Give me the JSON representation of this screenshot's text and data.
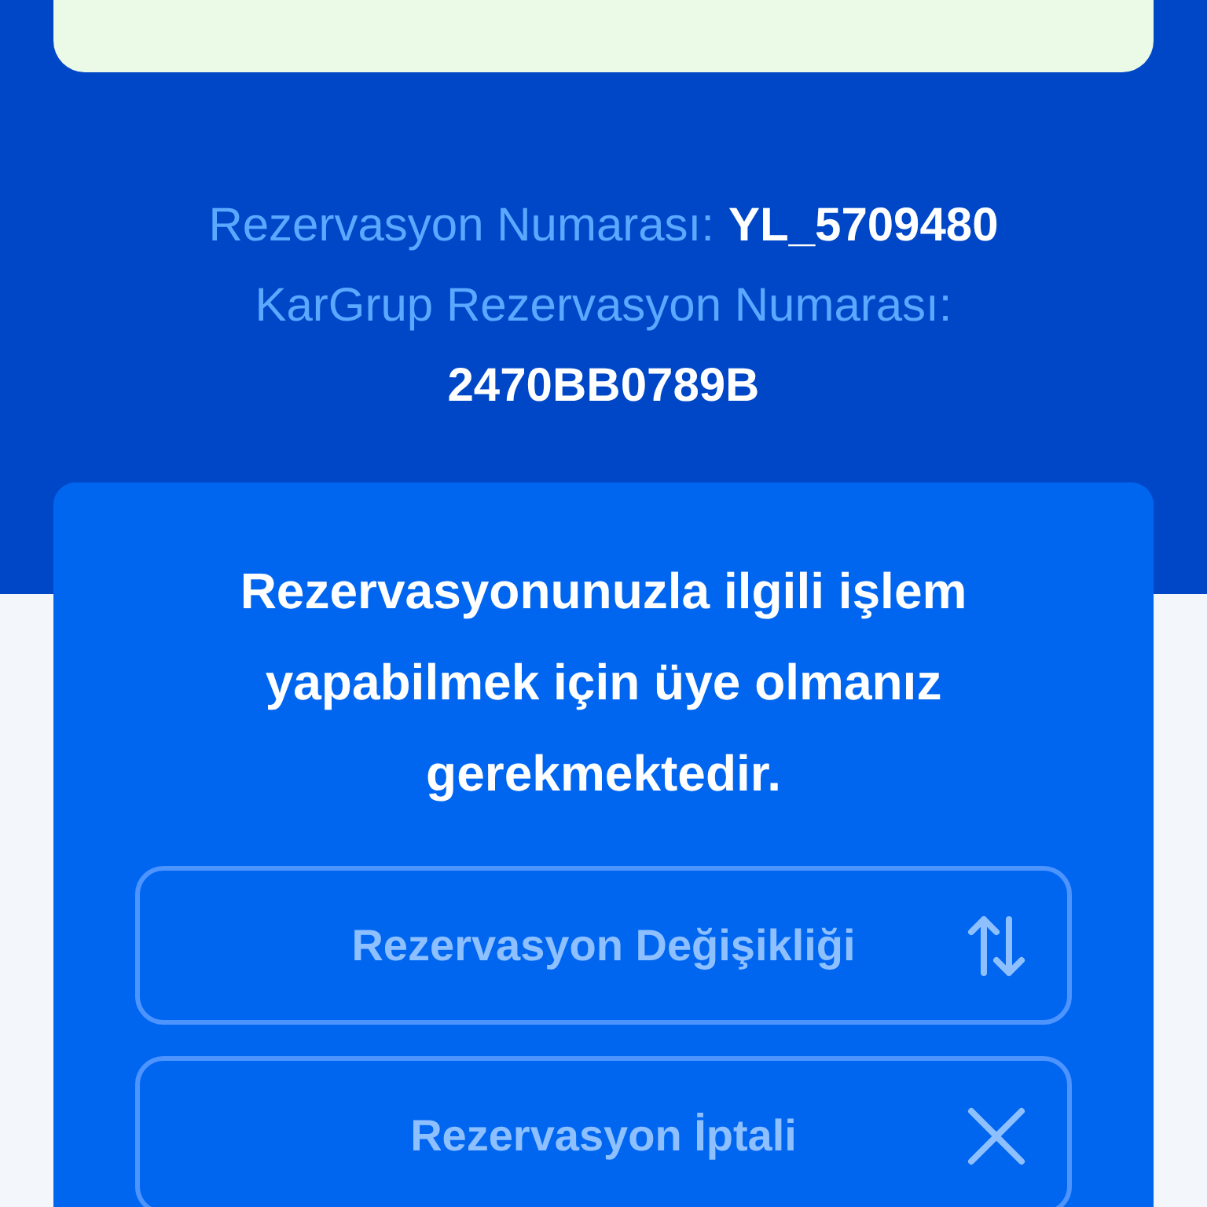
{
  "reservation": {
    "number_label": "Rezervasyon Numarası:",
    "number": "YL_5709480",
    "kargrup_label": "KarGrup Rezervasyon Numarası:",
    "kargrup_number": "2470BB0789B"
  },
  "member_notice": {
    "message": "Rezervasyonunuzla ilgili işlem yapabilmek için üye olmanız gerekmektedir.",
    "actions": [
      {
        "label": "Rezervasyon Değişikliği",
        "kind": "change",
        "disabled": true
      },
      {
        "label": "Rezervasyon İptali",
        "kind": "cancel",
        "disabled": true
      }
    ]
  }
}
